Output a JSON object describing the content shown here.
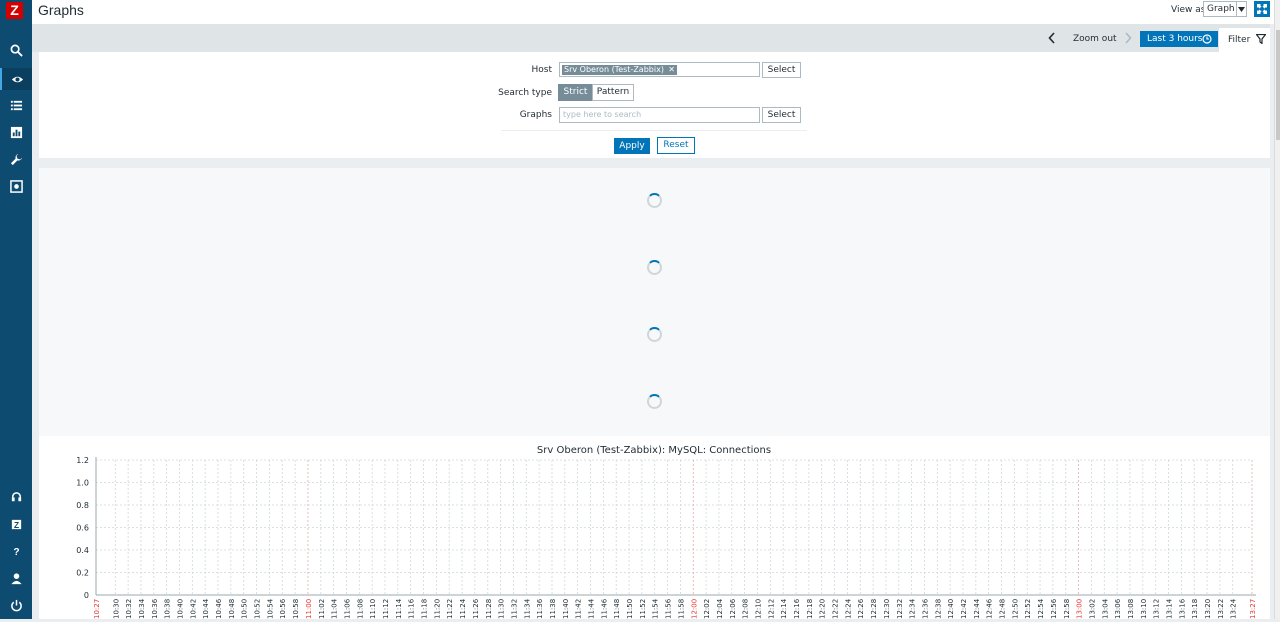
{
  "sidebar": {
    "logo": "Z",
    "icons": [
      "search-icon",
      "eye-icon",
      "list-icon",
      "reports-icon",
      "wrench-icon",
      "gear-icon",
      "support-icon",
      "share-icon",
      "help-icon",
      "user-icon",
      "power-icon"
    ]
  },
  "header": {
    "title": "Graphs",
    "view_as_label": "View as",
    "view_as_value": "Graph"
  },
  "timebar": {
    "zoom_out": "Zoom out",
    "range": "Last 3 hours",
    "filter_tab": "Filter"
  },
  "filter": {
    "host_label": "Host",
    "host_chip": "Srv Oberon (Test-Zabbix)",
    "host_select": "Select",
    "search_type_label": "Search type",
    "search_strict": "Strict",
    "search_pattern": "Pattern",
    "graphs_label": "Graphs",
    "graphs_placeholder": "type here to search",
    "graphs_select": "Select",
    "apply": "Apply",
    "reset": "Reset"
  },
  "colors": {
    "sidebar": "#0e4b70",
    "accent": "#0275b8",
    "marker": "#e33734"
  },
  "chart_data": {
    "type": "line",
    "title": "Srv Oberon (Test-Zabbix): MySQL: Connections",
    "ylim": [
      0,
      1.2
    ],
    "yticks": [
      "1.2",
      "1.0",
      "0.8",
      "0.6",
      "0.4",
      "0.2",
      "0"
    ],
    "x_start": "10:27",
    "x_end": "13:27",
    "x_ticks": [
      "10:30",
      "10:32",
      "10:34",
      "10:36",
      "10:38",
      "10:40",
      "10:42",
      "10:44",
      "10:46",
      "10:48",
      "10:50",
      "10:52",
      "10:54",
      "10:56",
      "10:58",
      "11:00",
      "11:02",
      "11:04",
      "11:06",
      "11:08",
      "11:10",
      "11:12",
      "11:14",
      "11:16",
      "11:18",
      "11:20",
      "11:22",
      "11:24",
      "11:26",
      "11:28",
      "11:30",
      "11:32",
      "11:34",
      "11:36",
      "11:38",
      "11:40",
      "11:42",
      "11:44",
      "11:46",
      "11:48",
      "11:50",
      "11:52",
      "11:54",
      "11:56",
      "11:58",
      "12:00",
      "12:02",
      "12:04",
      "12:06",
      "12:08",
      "12:10",
      "12:12",
      "12:14",
      "12:16",
      "12:18",
      "12:20",
      "12:22",
      "12:24",
      "12:26",
      "12:28",
      "12:30",
      "12:32",
      "12:34",
      "12:36",
      "12:38",
      "12:40",
      "12:42",
      "12:44",
      "12:46",
      "12:48",
      "12:50",
      "12:52",
      "12:54",
      "12:56",
      "12:58",
      "13:00",
      "13:02",
      "13:04",
      "13:06",
      "13:08",
      "13:10",
      "13:12",
      "13:14",
      "13:16",
      "13:18",
      "13:20",
      "13:22",
      "13:24"
    ],
    "highlight_ticks": [
      "10:27",
      "11:00",
      "12:00",
      "13:00",
      "13:27"
    ],
    "grid": true
  }
}
